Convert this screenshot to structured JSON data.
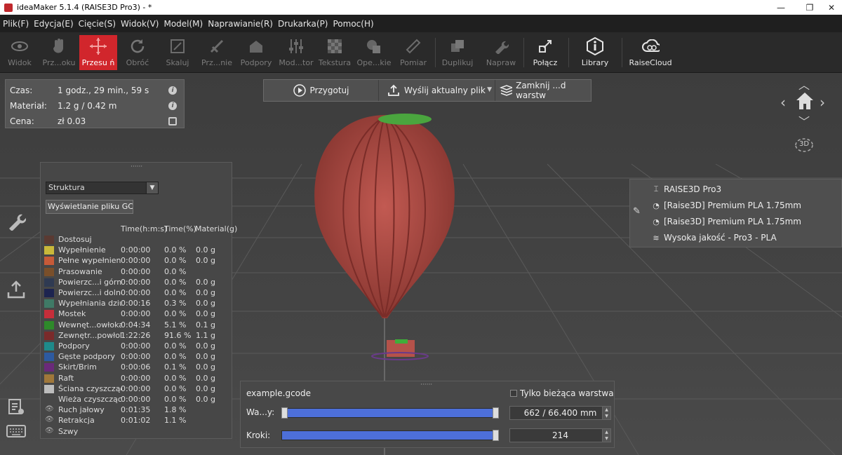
{
  "window": {
    "title": "ideaMaker 5.1.4 (RAISE3D Pro3) - *",
    "minimize": "—",
    "maximize": "❐",
    "close": "✕"
  },
  "menu": [
    "Plik(F)",
    "Edycja(E)",
    "Cięcie(S)",
    "Widok(V)",
    "Model(M)",
    "Naprawianie(R)",
    "Drukarka(P)",
    "Pomoc(H)"
  ],
  "toolbar": {
    "widok": "Widok",
    "przenies": "Prz...oku",
    "przesun": "Przesu ń",
    "obroc": "Obróć",
    "skaluj": "Skaluj",
    "przetnij": "Prz...nie",
    "podpory": "Podpory",
    "modyfikator": "Mod...tor",
    "tekstura": "Tekstura",
    "operacje": "Ope...kie",
    "pomiar": "Pomiar",
    "duplikuj": "Duplikuj",
    "napraw": "Napraw",
    "polacz": "Połącz",
    "library": "Library",
    "raisecloud": "RaiseCloud"
  },
  "info": {
    "czas_label": "Czas:",
    "czas_value": "1 godz., 29 min., 59 s",
    "material_label": "Materiał:",
    "material_value": "1.2 g / 0.42 m",
    "cena_label": "Cena:",
    "cena_value": "zł 0.03"
  },
  "actions": {
    "przygotuj": "Przygotuj",
    "wyslij": "Wyślij aktualny plik",
    "zamknij": "Zamknij ...d warstw"
  },
  "legend": {
    "dropdown": "Struktura",
    "gcode_button": "Wyświetlanie pliku GCode",
    "col_time": "Time(h:m:s)",
    "col_pct": "Time(%)",
    "col_mat": "Material(g)",
    "rows": [
      {
        "name": "Dostosuj",
        "time": "",
        "pct": "",
        "mat": "",
        "color": "#5a3a32"
      },
      {
        "name": "Wypełnienie",
        "time": "0:00:00",
        "pct": "0.0 %",
        "mat": "0.0 g",
        "color": "#c9b83a"
      },
      {
        "name": "Pełne wypełnienie",
        "time": "0:00:00",
        "pct": "0.0 %",
        "mat": "0.0 g",
        "color": "#c75a38"
      },
      {
        "name": "Prasowanie",
        "time": "0:00:00",
        "pct": "0.0 %",
        "mat": "",
        "color": "#7a4f2a"
      },
      {
        "name": "Powierzc...i górnej",
        "time": "0:00:00",
        "pct": "0.0 %",
        "mat": "0.0 g",
        "color": "#2f3a52"
      },
      {
        "name": "Powierzc...i dolnej",
        "time": "0:00:00",
        "pct": "0.0 %",
        "mat": "0.0 g",
        "color": "#1d2450"
      },
      {
        "name": "Wypełniania dziur",
        "time": "0:00:16",
        "pct": "0.3 %",
        "mat": "0.0 g",
        "color": "#3f7a66"
      },
      {
        "name": "Mostek",
        "time": "0:00:00",
        "pct": "0.0 %",
        "mat": "0.0 g",
        "color": "#c62e3a"
      },
      {
        "name": "Wewnęt...owłoka",
        "time": "0:04:34",
        "pct": "5.1 %",
        "mat": "0.1 g",
        "color": "#2e8a2a"
      },
      {
        "name": "Zewnętr...powłoka",
        "time": "1:22:26",
        "pct": "91.6 %",
        "mat": "1.1 g",
        "color": "#7a2a2a"
      },
      {
        "name": "Podpory",
        "time": "0:00:00",
        "pct": "0.0 %",
        "mat": "0.0 g",
        "color": "#1e8a8a"
      },
      {
        "name": "Gęste podpory",
        "time": "0:00:00",
        "pct": "0.0 %",
        "mat": "0.0 g",
        "color": "#2d5aa0"
      },
      {
        "name": "Skirt/Brim",
        "time": "0:00:06",
        "pct": "0.1 %",
        "mat": "0.0 g",
        "color": "#6a2a7a"
      },
      {
        "name": "Raft",
        "time": "0:00:00",
        "pct": "0.0 %",
        "mat": "0.0 g",
        "color": "#a0783a"
      },
      {
        "name": "Ściana czyszcząca",
        "time": "0:00:00",
        "pct": "0.0 %",
        "mat": "0.0 g",
        "color": "#bdbdbd"
      },
      {
        "name": "Wieża czyszcząca",
        "time": "0:00:00",
        "pct": "0.0 %",
        "mat": "0.0 g",
        "color": "#474747"
      },
      {
        "name": "Ruch jałowy",
        "time": "0:01:35",
        "pct": "1.8 %",
        "mat": "",
        "color": "eye"
      },
      {
        "name": "Retrakcja",
        "time": "0:01:02",
        "pct": "1.1 %",
        "mat": "",
        "color": "eye"
      },
      {
        "name": "Szwy",
        "time": "",
        "pct": "",
        "mat": "",
        "color": "eye"
      }
    ]
  },
  "printer": {
    "model": "RAISE3D Pro3",
    "filament1": "[Raise3D] Premium PLA 1.75mm",
    "filament2": "[Raise3D] Premium PLA 1.75mm",
    "profile": "Wysoka jakość - Pro3 - PLA"
  },
  "layers": {
    "file": "example.gcode",
    "only_current": "Tylko bieżąca warstwa",
    "layers_label": "Wa...y:",
    "layers_value": "662 / 66.400 mm",
    "steps_label": "Kroki:",
    "steps_value": "214",
    "layer_fraction": 1.0,
    "step_fraction": 1.0
  },
  "nav": {
    "label_3d": "3D"
  },
  "colors": {
    "accent": "#d1262c",
    "track": "#4d6fd9",
    "balloon": "#b5524a",
    "top": "#3fae3a"
  }
}
